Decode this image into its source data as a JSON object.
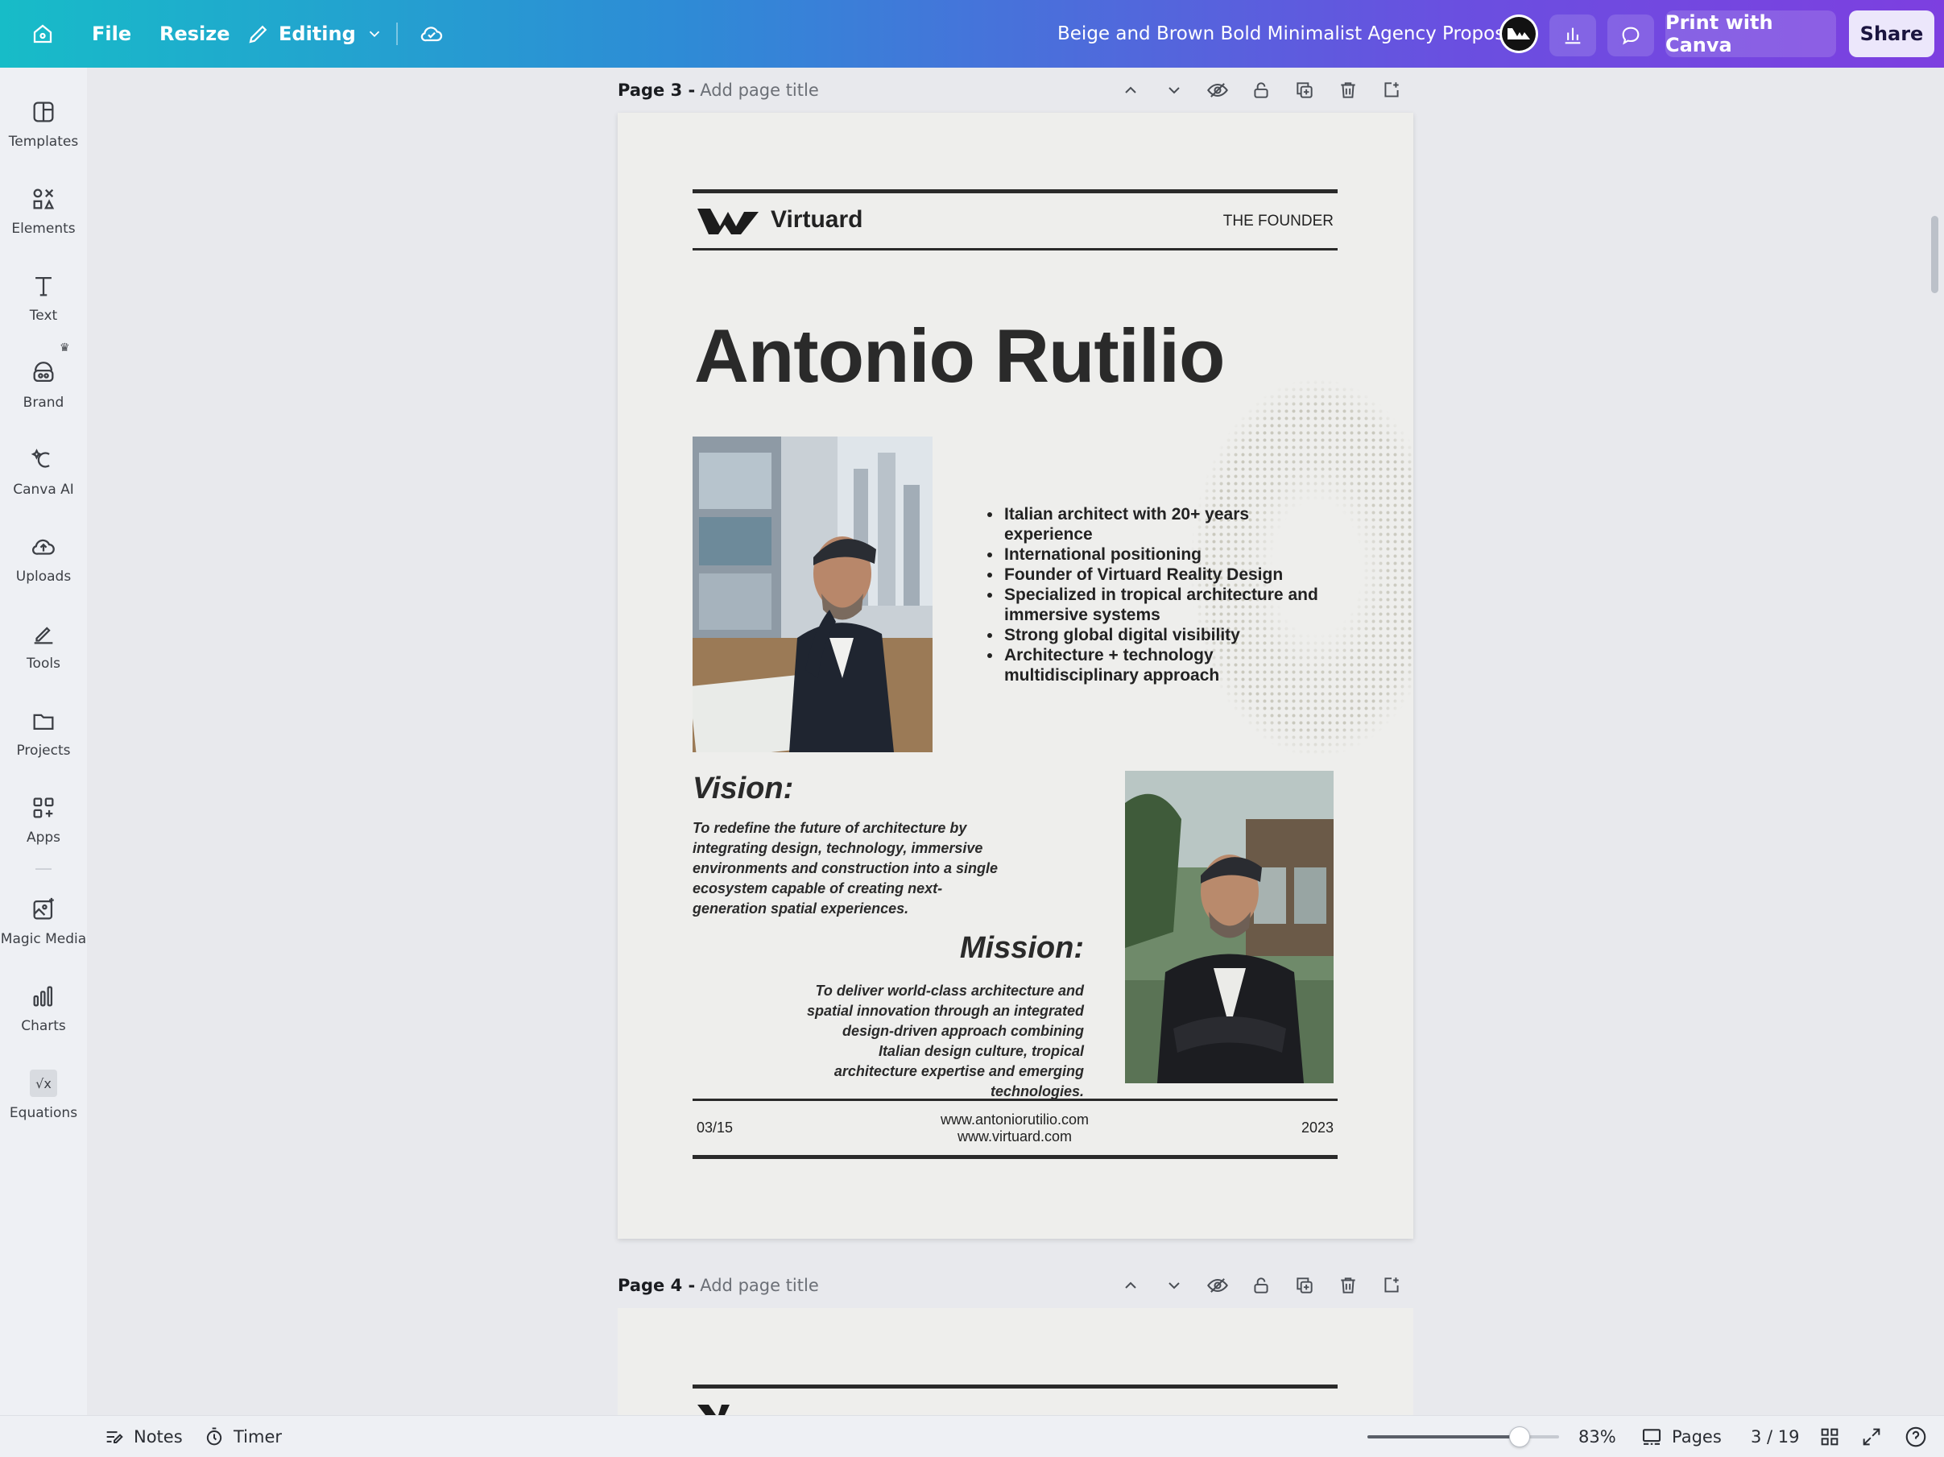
{
  "topbar": {
    "file_label": "File",
    "resize_label": "Resize",
    "editing_label": "Editing",
    "doc_title": "Beige and Brown Bold Minimalist Agency Proposal",
    "print_label": "Print with Canva",
    "share_label": "Share"
  },
  "sidebar": {
    "items": [
      {
        "label": "Templates",
        "icon": "templates-icon"
      },
      {
        "label": "Elements",
        "icon": "elements-icon"
      },
      {
        "label": "Text",
        "icon": "text-icon"
      },
      {
        "label": "Brand",
        "icon": "brand-icon"
      },
      {
        "label": "Canva AI",
        "icon": "canva-ai-icon"
      },
      {
        "label": "Uploads",
        "icon": "uploads-icon"
      },
      {
        "label": "Tools",
        "icon": "tools-icon"
      },
      {
        "label": "Projects",
        "icon": "projects-icon"
      },
      {
        "label": "Apps",
        "icon": "apps-icon"
      },
      {
        "label": "Magic Media",
        "icon": "magic-media-icon"
      },
      {
        "label": "Charts",
        "icon": "charts-icon"
      },
      {
        "label": "Equations",
        "icon": "equations-icon"
      }
    ]
  },
  "page3": {
    "number_label": "Page 3 -",
    "title_placeholder": "Add page title",
    "brand_name": "Virtuard",
    "section_label": "THE FOUNDER",
    "heading": "Antonio Rutilio",
    "bullets": [
      "Italian architect with 20+ years experience",
      "International positioning",
      "Founder of Virtuard Reality Design",
      "Specialized in tropical architecture and immersive systems",
      "Strong global digital visibility",
      "Architecture + technology multidisciplinary approach"
    ],
    "vision_title": "Vision:",
    "vision_text": "To redefine the future of architecture by integrating design, technology, immersive environments and construction into a single ecosystem capable of creating next-generation spatial experiences.",
    "mission_title": "Mission:",
    "mission_text": "To deliver world-class architecture and spatial innovation through an integrated design-driven approach combining Italian design culture, tropical architecture expertise and emerging technologies.",
    "footer_page": "03/15",
    "footer_url1": "www.antoniorutilio.com",
    "footer_url2": "www.virtuard.com",
    "footer_year": "2023"
  },
  "page4": {
    "number_label": "Page 4 -",
    "title_placeholder": "Add page title"
  },
  "bottombar": {
    "notes_label": "Notes",
    "timer_label": "Timer",
    "zoom_level": 83,
    "zoom_label": "83%",
    "pages_label": "Pages",
    "page_counter": "3 / 19"
  },
  "colors": {
    "page_bg": "#eeeeec",
    "text_dark": "#222222",
    "accent_gradient_start": "#17bcc8",
    "accent_gradient_end": "#7d3fe0"
  }
}
